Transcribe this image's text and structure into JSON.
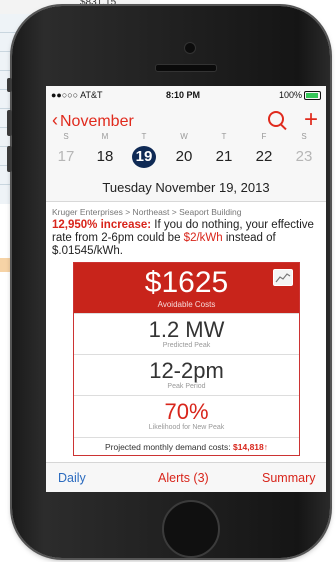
{
  "background": {
    "top_text": "$831.15"
  },
  "status_bar": {
    "carrier": "●●○○○ AT&T",
    "time": "8:10 PM",
    "battery": "100%"
  },
  "nav": {
    "back_label": "November"
  },
  "week": {
    "letters": [
      "S",
      "M",
      "T",
      "W",
      "T",
      "F",
      "S"
    ],
    "days": [
      "17",
      "18",
      "19",
      "20",
      "21",
      "22",
      "23"
    ],
    "selected_index": 2
  },
  "date_line": "Tuesday  November 19, 2013",
  "breadcrumb": "Kruger Enterprises > Northeast > Seaport Building",
  "alert": {
    "headline": "12,950% increase:",
    "body1": " If you do nothing, your effective rate from 2-6pm could be ",
    "rate": "$2/kWh",
    "body2": " instead of $.01545/kWh."
  },
  "card": {
    "avoidable_value": "$1625",
    "avoidable_label": "Avoidable Costs",
    "peak_value": "1.2 MW",
    "peak_label": "Predicted Peak",
    "period_value": "12-2pm",
    "period_label": "Peak Period",
    "likelihood_value": "70%",
    "likelihood_label": "Likelihood for New Peak",
    "projected_label": "Projected monthly demand costs:",
    "projected_value": "$14,818",
    "projected_arrow": "↑"
  },
  "tabs": {
    "daily": "Daily",
    "alerts": "Alerts (3)",
    "summary": "Summary"
  },
  "colors": {
    "accent_red": "#d8251b",
    "selected_day": "#0f2a55",
    "tab_blue": "#2b6bbf"
  }
}
